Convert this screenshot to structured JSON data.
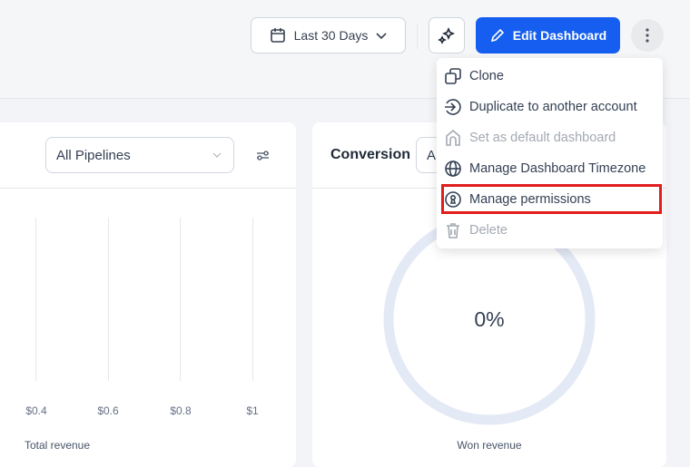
{
  "toolbar": {
    "date_range": "Last 30 Days",
    "edit_label": "Edit Dashboard"
  },
  "menu": {
    "items": [
      {
        "label": "Clone",
        "icon": "clone-icon",
        "disabled": false
      },
      {
        "label": "Duplicate to another account",
        "icon": "duplicate-icon",
        "disabled": false
      },
      {
        "label": "Set as default dashboard",
        "icon": "home-icon",
        "disabled": true
      },
      {
        "label": "Manage Dashboard Timezone",
        "icon": "globe-icon",
        "disabled": false
      },
      {
        "label": "Manage permissions",
        "icon": "permissions-icon",
        "disabled": false,
        "highlighted": true
      },
      {
        "label": "Delete",
        "icon": "trash-icon",
        "disabled": true
      }
    ]
  },
  "revenue_card": {
    "pipeline": "All Pipelines",
    "ticks": [
      "$0.4",
      "$0.6",
      "$0.8",
      "$1"
    ],
    "caption": "Total revenue"
  },
  "conversion_card": {
    "title": "Conversion",
    "select_partial": "A",
    "value": "0%",
    "caption": "Won revenue"
  },
  "colors": {
    "accent": "#155eef",
    "highlight": "#e11d1d",
    "donut": "#e3e9f5"
  }
}
